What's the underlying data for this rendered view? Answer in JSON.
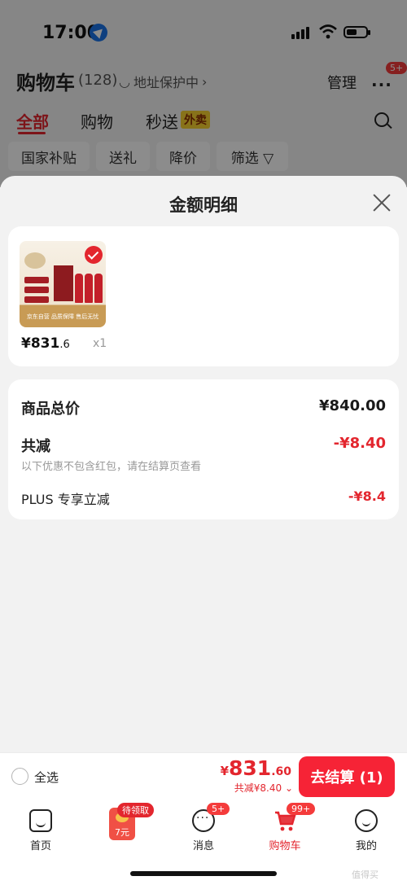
{
  "status_bar": {
    "time": "17:00"
  },
  "header": {
    "title": "购物车",
    "count": "(128)",
    "address_protect": "地址保护中",
    "manage": "管理",
    "more_badge": "5+"
  },
  "tabs": [
    {
      "label": "全部"
    },
    {
      "label": "购物"
    },
    {
      "label": "秒送"
    }
  ],
  "waimai_tag": "外卖",
  "filters": [
    {
      "label": "国家补贴"
    },
    {
      "label": "送礼"
    },
    {
      "label": "降价"
    },
    {
      "label": "筛选 ▽"
    }
  ],
  "sheet": {
    "title": "金额明细",
    "product": {
      "price_main": "¥831",
      "price_cents": ".6",
      "qty": "x1",
      "image_strip": "京东自营 品质保障 售后无忧",
      "accent": "#c31f29"
    },
    "summary": {
      "total_label": "商品总价",
      "total_value": "¥840.00",
      "discount_label": "共减",
      "discount_value": "-¥8.40",
      "note": "以下优惠不包含红包，请在结算页查看",
      "plus_label": "PLUS 专享立减",
      "plus_value": "-¥8.4"
    }
  },
  "checkout": {
    "select_all": "全选",
    "currency": "¥",
    "total_main": "831",
    "total_decimal": ".60",
    "discount": "共减¥8.40",
    "button": "去结算 (1)",
    "button_color": "#f62336"
  },
  "tabbar": [
    {
      "label": "首页",
      "icon": "home-icon"
    },
    {
      "label": "",
      "icon": "coupon-icon",
      "badge": "待领取",
      "sub": "7元"
    },
    {
      "label": "消息",
      "icon": "message-icon",
      "badge": "5+"
    },
    {
      "label": "购物车",
      "icon": "cart-icon",
      "badge": "99+",
      "active": true
    },
    {
      "label": "我的",
      "icon": "profile-icon"
    }
  ],
  "watermark": "值得买"
}
